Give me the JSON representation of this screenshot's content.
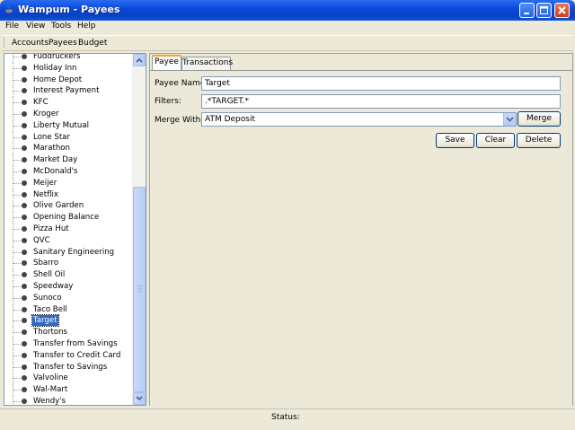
{
  "window": {
    "title": "Wampum - Payees"
  },
  "menubar": {
    "items": [
      "File",
      "View",
      "Tools",
      "Help"
    ]
  },
  "toolbar": {
    "items": [
      "Accounts",
      "Payees",
      "Budget"
    ]
  },
  "tree": {
    "items": [
      "Fuddruckers",
      "Holiday Inn",
      "Home Depot",
      "Interest Payment",
      "KFC",
      "Kroger",
      "Liberty Mutual",
      "Lone Star",
      "Marathon",
      "Market Day",
      "McDonald's",
      "Meijer",
      "Netflix",
      "Olive Garden",
      "Opening Balance",
      "Pizza Hut",
      "QVC",
      "Sanitary Engineering",
      "Sbarro",
      "Shell Oil",
      "Speedway",
      "Sunoco",
      "Taco Bell",
      "Target",
      "Thortons",
      "Transfer from Savings",
      "Transfer to Credit Card",
      "Transfer to Savings",
      "Valvoline",
      "Wal-Mart",
      "Wendy's"
    ],
    "selected": "Target"
  },
  "tabs": [
    "Payee",
    "Transactions"
  ],
  "form": {
    "payee_name_label": "Payee Name:",
    "payee_name_value": "Target",
    "filters_label": "Filters:",
    "filters_value": ".*TARGET.*",
    "merge_with_label": "Merge With:",
    "merge_with_value": "ATM Deposit",
    "merge_button": "Merge",
    "save_button": "Save",
    "clear_button": "Clear",
    "delete_button": "Delete"
  },
  "status": {
    "label": "Status:"
  },
  "colors": {
    "title_bar": "#0a46d8",
    "selection": "#316ac5",
    "tab_highlight": "#f5a61d"
  }
}
